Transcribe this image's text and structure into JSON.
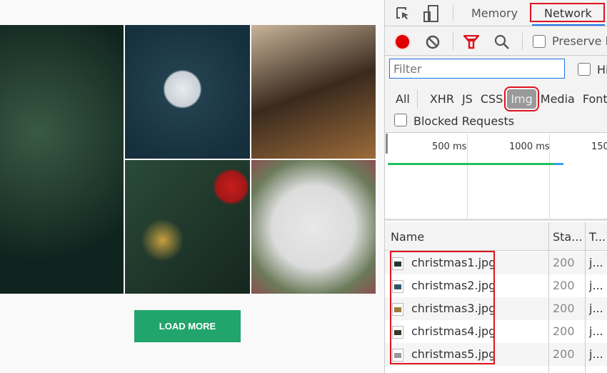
{
  "page": {
    "load_more_label": "LOAD MORE",
    "images": [
      {
        "name": "christmas1",
        "c": "#17302a",
        "c2": "#2f4a3b"
      },
      {
        "name": "christmas2",
        "c": "#1f3b48",
        "c2": "#cfd6db"
      },
      {
        "name": "christmas3",
        "c": "#3a2a1e",
        "c2": "#d9a35a"
      },
      {
        "name": "christmas4",
        "c": "#1e3328",
        "c2": "#b52020"
      },
      {
        "name": "christmas5",
        "c": "#dcdcdc",
        "c2": "#6b7b5a"
      }
    ]
  },
  "devtools": {
    "tabs": {
      "memory": "Memory",
      "network": "Network"
    },
    "toolbar": {
      "preserve_log": "Preserve log"
    },
    "filter": {
      "placeholder": "Filter",
      "hide_data_urls": "Hi"
    },
    "types": [
      "All",
      "XHR",
      "JS",
      "CSS",
      "Img",
      "Media",
      "Font"
    ],
    "active_type": "Img",
    "blocked_requests": "Blocked Requests",
    "timeline": {
      "ticks": [
        "500 ms",
        "1000 ms",
        "150"
      ]
    },
    "table": {
      "headers": {
        "name": "Name",
        "status": "Sta...",
        "type": "T..."
      },
      "rows": [
        {
          "name": "christmas1.jpg",
          "status": "200",
          "type": "j...",
          "thumb": "#1c3a30"
        },
        {
          "name": "christmas2.jpg",
          "status": "200",
          "type": "j...",
          "thumb": "#2c5468"
        },
        {
          "name": "christmas3.jpg",
          "status": "200",
          "type": "j...",
          "thumb": "#a07a3a"
        },
        {
          "name": "christmas4.jpg",
          "status": "200",
          "type": "j...",
          "thumb": "#3a3a2a"
        },
        {
          "name": "christmas5.jpg",
          "status": "200",
          "type": "j...",
          "thumb": "#999999"
        }
      ]
    },
    "colors": {
      "record": "#e00000",
      "highlight": "#e0141e",
      "active_tab_underline": "#1a73e8",
      "filter_icon": "#e0141e"
    }
  }
}
